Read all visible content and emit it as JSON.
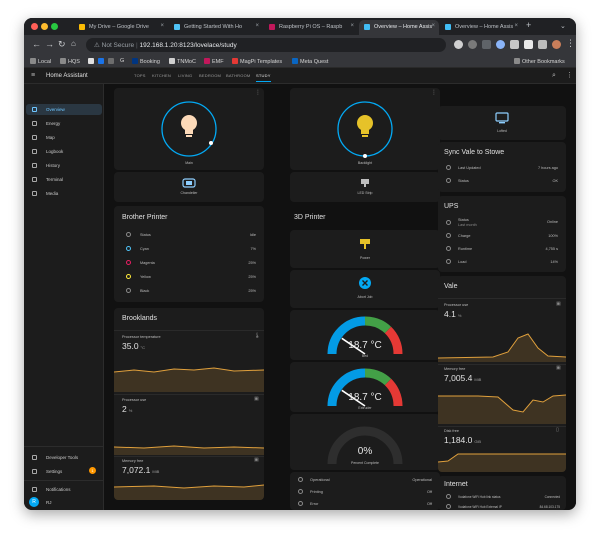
{
  "browser": {
    "tabs": [
      {
        "label": "My Drive – Google Drive",
        "fav": "#fbbc04"
      },
      {
        "label": "Getting Started With Ho",
        "fav": "#4fc3f7"
      },
      {
        "label": "Raspberry Pi OS – Raspb",
        "fav": "#c2185b"
      },
      {
        "label": "Overview – Home Assis",
        "fav": "#41bdf5"
      },
      {
        "label": "Overview – Home Assis",
        "fav": "#41bdf5"
      }
    ],
    "new_tab": "+",
    "close": "×",
    "address_prefix": "Not Secure",
    "address": "192.168.1.20:8123/lovelace/study",
    "bookmarks": [
      "Local",
      "HQS",
      "G",
      "Booking",
      "TNMoC",
      "EMF",
      "MagPi Templates",
      "Meta Quest"
    ],
    "other_bookmarks": "Other Bookmarks"
  },
  "ha": {
    "app_title": "Home Assistant",
    "view_tabs": [
      "TOPS",
      "KITCHEN",
      "LIVING",
      "BEDROOM",
      "BATHROOM",
      "STUDY"
    ],
    "sidebar": [
      "Overview",
      "Energy",
      "Map",
      "Logbook",
      "History",
      "Terminal",
      "Media"
    ],
    "sidebar_bottom": [
      "Developer Tools",
      "Settings",
      "Notifications"
    ],
    "settings_badge": "1",
    "user_initial": "R",
    "user_name": "RJ"
  },
  "cards": {
    "main_light": "Main",
    "chandelier": "Chandelier",
    "backlight": "Backlight",
    "led_strip": "LED Strip",
    "lofted": "Lofted",
    "printer": {
      "title": "Brother Printer",
      "rows": [
        {
          "label": "Status",
          "value": "Idle"
        },
        {
          "label": "Cyan",
          "value": "7%"
        },
        {
          "label": "Magenta",
          "value": "25%"
        },
        {
          "label": "Yellow",
          "value": "25%"
        },
        {
          "label": "Black",
          "value": "25%"
        }
      ]
    },
    "sync": {
      "title": "Sync Vale to Stowe",
      "rows": [
        {
          "label": "Last Updated",
          "value": "7 hours ago"
        },
        {
          "label": "Status",
          "value": "OK"
        }
      ]
    },
    "ups": {
      "title": "UPS",
      "rows": [
        {
          "label": "Status",
          "sub": "Last month",
          "value": "Online"
        },
        {
          "label": "Charge",
          "sub": "",
          "value": "100%"
        },
        {
          "label": "Runtime",
          "sub": "",
          "value": "4,755 s"
        },
        {
          "label": "Load",
          "sub": "",
          "value": "14%"
        }
      ]
    },
    "printer3d": {
      "title": "3D Printer",
      "power": "Power",
      "stop": "Abort Job",
      "bed": {
        "value": "18.7 °C",
        "label": "Bed",
        "fraction": 0.19
      },
      "extruder": {
        "value": "18.7 °C",
        "label": "Extruder",
        "fraction": 0.19
      },
      "progress": {
        "value": "0%",
        "label": "Percent Complete"
      },
      "rows": [
        {
          "label": "Operational",
          "value": "Operational"
        },
        {
          "label": "Printing",
          "value": "Off"
        },
        {
          "label": "Error",
          "value": "Off"
        }
      ]
    },
    "brooklands": {
      "title": "Brooklands",
      "temp": {
        "label": "Processor temperature",
        "value": "35.0",
        "unit": "°C"
      },
      "proc": {
        "label": "Processor use",
        "value": "2",
        "unit": "%"
      },
      "mem": {
        "label": "Memory free",
        "value": "7,072.1",
        "unit": "MiB"
      }
    },
    "vale": {
      "title": "Vale",
      "proc": {
        "label": "Processor use",
        "value": "4.1",
        "unit": "%"
      },
      "mem": {
        "label": "Memory free",
        "value": "7,005.4",
        "unit": "MiB"
      },
      "disk": {
        "label": "Disk free",
        "value": "1,184.0",
        "unit": "GiB"
      }
    },
    "internet": {
      "title": "Internet",
      "rows": [
        {
          "label": "Vodafone WiFi Hub link status",
          "value": "Connected"
        },
        {
          "label": "Vodafone WiFi Hub External IP",
          "value": "84.68.103.175"
        }
      ]
    }
  },
  "colors": {
    "accent": "#03a9f4",
    "light_on": "#fcd9b8",
    "backlight": "#e6c229",
    "history": "#e0a03c"
  }
}
